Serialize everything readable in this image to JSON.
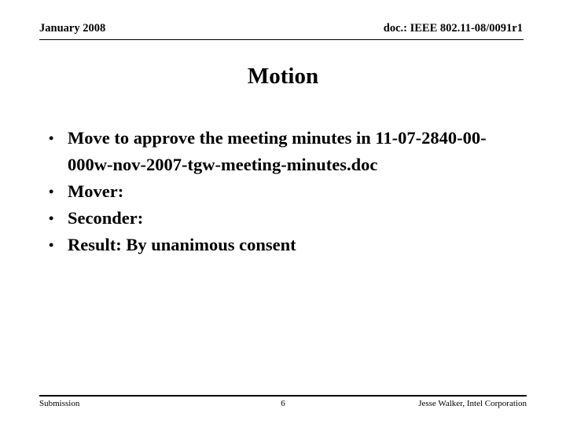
{
  "header": {
    "date": "January 2008",
    "doc": "doc.: IEEE 802.11-08/0091r1"
  },
  "title": "Motion",
  "body": {
    "bullet_glyph": "•",
    "items": [
      {
        "text": "Move to approve the meeting minutes in 11-07-2840-00-000w-nov-2007-tgw-meeting-minutes.doc"
      },
      {
        "text": "Mover:"
      },
      {
        "text": "Seconder:"
      },
      {
        "text": "Result: By unanimous consent"
      }
    ]
  },
  "footer": {
    "left": "Submission",
    "page_number": "6",
    "right": "Jesse Walker, Intel Corporation"
  },
  "colors": {
    "text": "#000000",
    "background": "#ffffff",
    "rule": "#000000"
  }
}
